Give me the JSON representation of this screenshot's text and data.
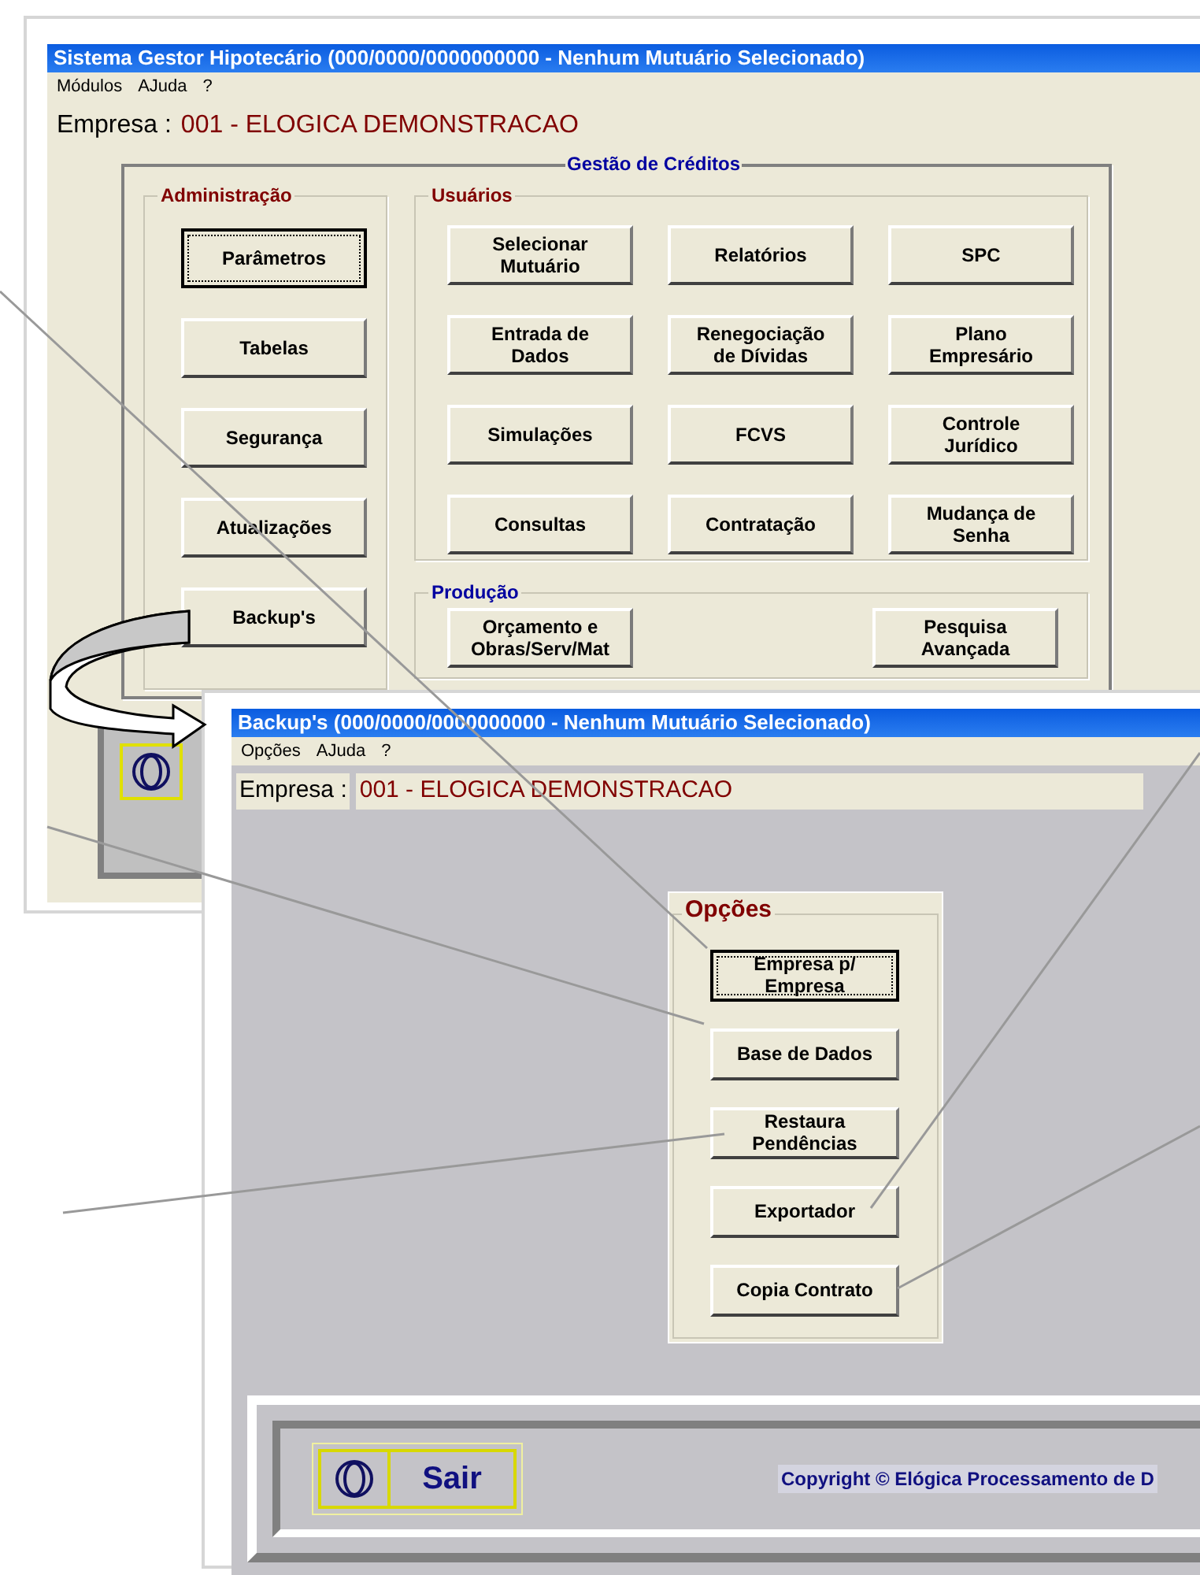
{
  "main_window": {
    "title": "Sistema Gestor Hipotecário (000/0000/0000000000 - Nenhum Mutuário Selecionado)",
    "menu": [
      "Módulos",
      "AJuda",
      "?"
    ],
    "empresa_label": "Empresa :",
    "empresa_value": "001 - ELOGICA DEMONSTRACAO",
    "frame_title": "Gestão de Créditos",
    "groups": [
      {
        "kind": "column",
        "title": "Administração",
        "color": "#800000",
        "buttons": [
          {
            "label": "Parâmetros",
            "focused": true
          },
          {
            "label": "Tabelas",
            "focused": false
          },
          {
            "label": "Segurança",
            "focused": false
          },
          {
            "label": "Atualizações",
            "focused": false
          },
          {
            "label": "Backup's",
            "focused": false
          }
        ]
      },
      {
        "kind": "grid",
        "title": "Usuários",
        "color": "#800000",
        "buttons": [
          {
            "label": "Selecionar\nMutuário",
            "focused": false
          },
          {
            "label": "Relatórios",
            "focused": false
          },
          {
            "label": "SPC",
            "focused": false
          },
          {
            "label": "Entrada de\nDados",
            "focused": false
          },
          {
            "label": "Renegociação\nde Dívidas",
            "focused": false
          },
          {
            "label": "Plano\nEmpresário",
            "focused": false
          },
          {
            "label": "Simulações",
            "focused": false
          },
          {
            "label": "FCVS",
            "focused": false
          },
          {
            "label": "Controle\nJurídico",
            "focused": false
          },
          {
            "label": "Consultas",
            "focused": false
          },
          {
            "label": "Contratação",
            "focused": false
          },
          {
            "label": "Mudança de\nSenha",
            "focused": false
          }
        ]
      },
      {
        "kind": "row",
        "title": "Produção",
        "color": "#0000a0",
        "buttons": [
          {
            "label": "Orçamento e\nObras/Serv/Mat",
            "focused": false
          },
          {
            "label": "Pesquisa\nAvançada",
            "focused": false
          }
        ]
      }
    ]
  },
  "backup_window": {
    "title": "Backup's (000/0000/0000000000 - Nenhum Mutuário Selecionado)",
    "menu": [
      "Opções",
      "AJuda",
      "?"
    ],
    "empresa_label": "Empresa :",
    "empresa_value": "001 - ELOGICA DEMONSTRACAO",
    "group": {
      "title": "Opções",
      "color": "#800000",
      "buttons": [
        {
          "label": "Empresa p/\nEmpresa",
          "focused": true
        },
        {
          "label": "Base de Dados",
          "focused": false
        },
        {
          "label": "Restaura\nPendências",
          "focused": false
        },
        {
          "label": "Exportador",
          "focused": false
        },
        {
          "label": "Copia Contrato",
          "focused": false
        }
      ]
    },
    "exit_button": "Sair",
    "copyright": "Copyright © Elógica Processamento de D"
  }
}
